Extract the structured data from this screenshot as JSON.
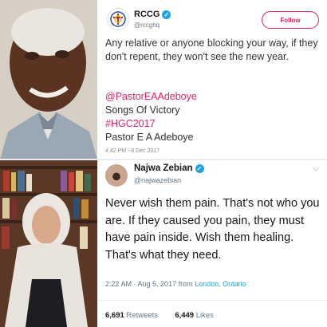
{
  "tweet1": {
    "name": "RCCG",
    "handle": "@rccghq",
    "follow_label": "Follow",
    "text": "Any relative or anyone blocking your way, if they don't repent, they won't see the new year.",
    "mention": "@PastorEAAdeboye",
    "line2": "Songs Of Victory",
    "hashtag": "#HGC2017",
    "line4": "Pastor E A Adeboye",
    "timestamp": "4:42 PM - 8 Dec 2017"
  },
  "tweet2": {
    "name": "Najwa Zebian",
    "handle": "@najwazebian",
    "text": "Never wish them pain. That's not who you are. If they caused you pain, they must have pain inside. Wish them healing. That's what they need.",
    "meta_prefix": "2:22 AM · Aug 5, 2017 from ",
    "location": "London, Ontario",
    "retweets_count": "6,691",
    "retweets_label": "Retweets",
    "likes_count": "6,449",
    "likes_label": "Likes"
  },
  "icons": {
    "verified": "verified-badge-icon",
    "more": "chevron-down-icon"
  },
  "colors": {
    "accent_pink": "#e0245e",
    "link_blue": "#1da1f2",
    "secondary_text": "#657786"
  }
}
